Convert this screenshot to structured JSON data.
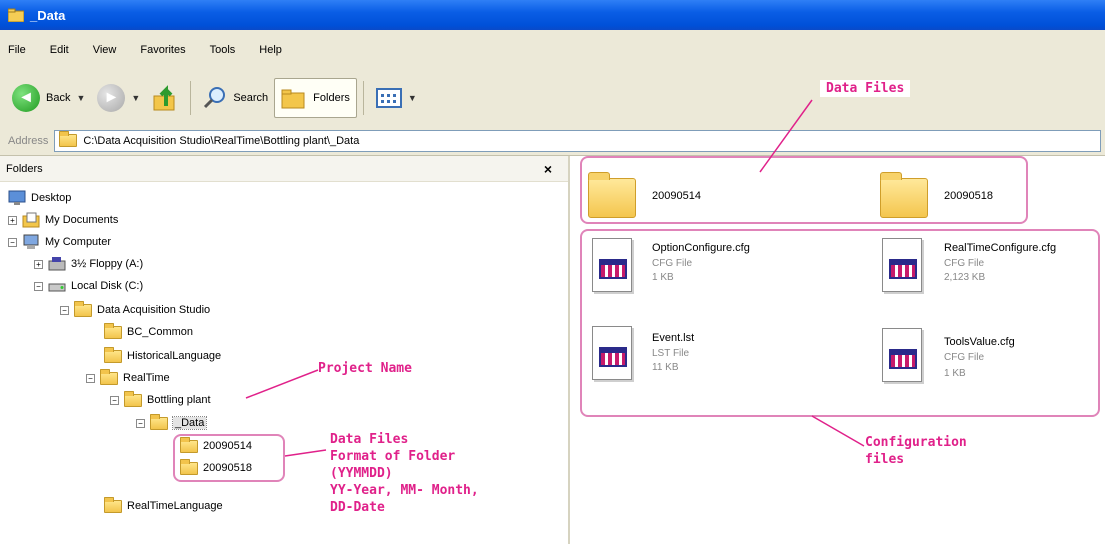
{
  "window": {
    "title": "_Data"
  },
  "menu": [
    "File",
    "Edit",
    "View",
    "Favorites",
    "Tools",
    "Help"
  ],
  "toolbar": {
    "back": "Back",
    "search": "Search",
    "folders": "Folders"
  },
  "address": {
    "label": "Address",
    "path": "C:\\Data Acquisition Studio\\RealTime\\Bottling plant\\_Data"
  },
  "folders_pane": {
    "title": "Folders",
    "close": "×",
    "tree": {
      "desktop": "Desktop",
      "my_documents": "My Documents",
      "my_computer": "My Computer",
      "floppy": "3½ Floppy (A:)",
      "local_disk": "Local Disk (C:)",
      "das": "Data Acquisition Studio",
      "bc_common": "BC_Common",
      "historical_language": "HistoricalLanguage",
      "realtime": "RealTime",
      "bottling_plant": "Bottling plant",
      "data": "_Data",
      "d1": "20090514",
      "d2": "20090518",
      "realtime_language": "RealTimeLanguage"
    }
  },
  "files": {
    "folders": [
      {
        "name": "20090514"
      },
      {
        "name": "20090518"
      }
    ],
    "items": [
      {
        "name": "OptionConfigure.cfg",
        "type": "CFG File",
        "size": "1 KB"
      },
      {
        "name": "RealTimeConfigure.cfg",
        "type": "CFG File",
        "size": "2,123 KB"
      },
      {
        "name": "Event.lst",
        "type": "LST File",
        "size": "11 KB"
      },
      {
        "name": "ToolsValue.cfg",
        "type": "CFG File",
        "size": "1 KB"
      }
    ]
  },
  "annotations": {
    "data_files_top": "Data Files",
    "project_name": "Project Name",
    "data_files_left": [
      "Data Files",
      "Format of Folder",
      "(YYMMDD)",
      "YY-Year, MM- Month,",
      "DD-Date"
    ],
    "configuration": [
      "Configuration",
      "files"
    ]
  },
  "colors": {
    "annotation": "#e0218a",
    "titlebar": "#0a5ee6",
    "chrome": "#ece9d8"
  }
}
